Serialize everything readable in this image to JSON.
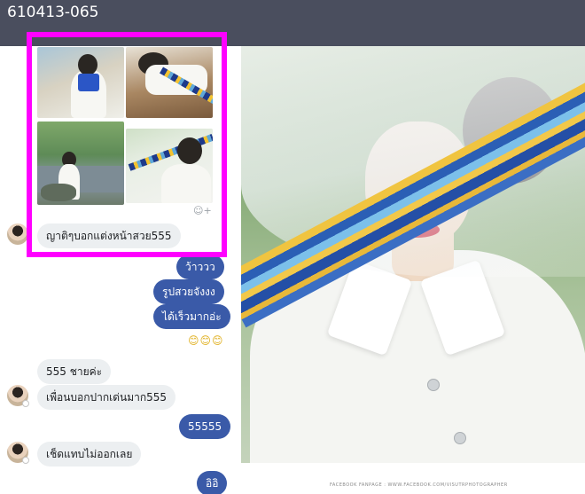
{
  "window": {
    "title": "610413-065"
  },
  "chat": {
    "messages": [
      {
        "id": "m1",
        "from": "them",
        "text": "ญาติๆบอกแต่งหน้าสวย555"
      },
      {
        "id": "m2",
        "from": "me",
        "text": "ว้าววว"
      },
      {
        "id": "m3",
        "from": "me",
        "text": "รูปสวยจังงง"
      },
      {
        "id": "m4",
        "from": "me",
        "text": "ได้เร็วมากอ่ะ"
      },
      {
        "id": "m5",
        "from": "me",
        "text": "😊😊😊"
      },
      {
        "id": "m6",
        "from": "them",
        "text": "555 ชายค่ะ"
      },
      {
        "id": "m7",
        "from": "them",
        "text": "เพื่อนบอกปากเด่นมาก555"
      },
      {
        "id": "m8",
        "from": "me",
        "text": "55555"
      },
      {
        "id": "m9",
        "from": "them",
        "text": "เช็ดแทบไม่ออกเลย"
      },
      {
        "id": "m10",
        "from": "me",
        "text": "อิอิ"
      }
    ],
    "photo_grid_reaction_icon": "add-reaction-icon"
  },
  "photo": {
    "watermark": "FACEBOOK FANPAGE : WWW.FACEBOOK.COM/VISUTRPHOTOGRAPHER"
  },
  "colors": {
    "topbar": "#4a4e5e",
    "outgoing_bubble": "#3a5aa8",
    "incoming_bubble": "#eceff1",
    "highlight": "#ff00ff"
  }
}
